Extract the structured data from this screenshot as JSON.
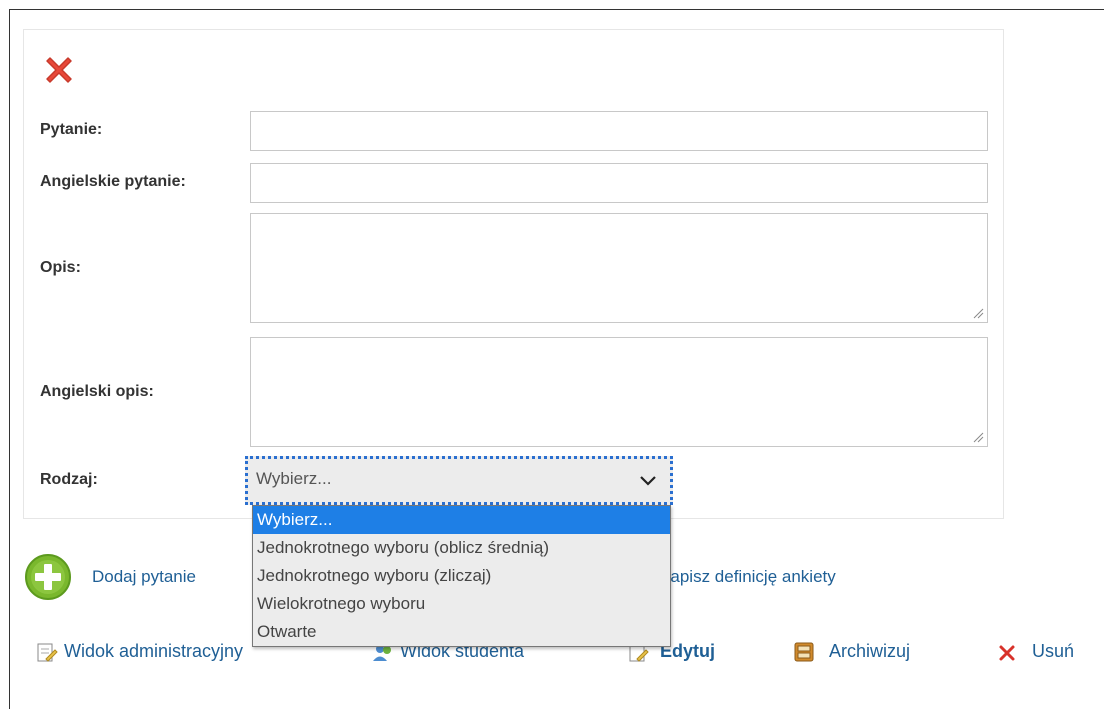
{
  "form": {
    "question_label": "Pytanie:",
    "question_en_label": "Angielskie pytanie:",
    "description_label": "Opis:",
    "description_en_label": "Angielski opis:",
    "type_label": "Rodzaj:",
    "type_selected": "Wybierz...",
    "type_options": [
      "Wybierz...",
      "Jednokrotnego wyboru (oblicz średnią)",
      "Jednokrotnego wyboru (zliczaj)",
      "Wielokrotnego wyboru",
      "Otwarte"
    ]
  },
  "actions": {
    "add_question": "Dodaj pytanie",
    "save_definition": "Zapisz definicję ankiety"
  },
  "bottom_toolbar": {
    "admin_view": "Widok administracyjny",
    "student_view": "Widok studenta",
    "edit": "Edytuj",
    "archive": "Archiwizuj",
    "delete": "Usuń"
  },
  "colors": {
    "delete_red": "#e8493a",
    "add_green": "#7ab82d",
    "link_blue": "#1f5f95",
    "select_highlight": "#1e7fe6"
  }
}
